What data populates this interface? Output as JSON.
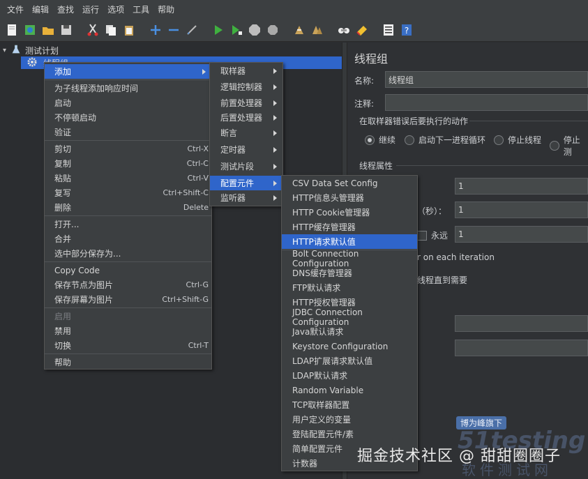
{
  "menubar": [
    "文件",
    "编辑",
    "查找",
    "运行",
    "选项",
    "工具",
    "帮助"
  ],
  "toolbar_icons": [
    "new-icon",
    "templates-icon",
    "open-icon",
    "save-icon",
    "cut-icon",
    "copy-icon",
    "paste-icon",
    "expand-icon",
    "collapse-icon",
    "toggle-icon",
    "start-icon",
    "start-no-pause-icon",
    "stop-icon",
    "shutdown-icon",
    "clear-icon",
    "clear-all-icon",
    "search-icon",
    "reset-search-icon",
    "function-helper-icon",
    "help-icon"
  ],
  "tree": {
    "test_plan": "测试计划",
    "thread_group": "线程组"
  },
  "context_menu": {
    "items": [
      {
        "label": "添加",
        "submenu": true,
        "highlight": true
      },
      {
        "sep": true
      },
      {
        "label": "为子线程添加响应时间"
      },
      {
        "label": "启动"
      },
      {
        "label": "不停顿启动"
      },
      {
        "label": "验证"
      },
      {
        "sep": true
      },
      {
        "label": "剪切",
        "shortcut": "Ctrl-X"
      },
      {
        "label": "复制",
        "shortcut": "Ctrl-C"
      },
      {
        "label": "粘贴",
        "shortcut": "Ctrl-V"
      },
      {
        "label": "复写",
        "shortcut": "Ctrl+Shift-C"
      },
      {
        "label": "删除",
        "shortcut": "Delete"
      },
      {
        "sep": true
      },
      {
        "label": "打开..."
      },
      {
        "label": "合并"
      },
      {
        "label": "选中部分保存为..."
      },
      {
        "sep": true
      },
      {
        "label": "Copy Code"
      },
      {
        "label": "保存节点为图片",
        "shortcut": "Ctrl-G"
      },
      {
        "label": "保存屏幕为图片",
        "shortcut": "Ctrl+Shift-G"
      },
      {
        "sep": true
      },
      {
        "label": "启用",
        "disabled": true
      },
      {
        "label": "禁用"
      },
      {
        "label": "切换",
        "shortcut": "Ctrl-T"
      },
      {
        "sep": true
      },
      {
        "label": "帮助"
      }
    ]
  },
  "add_submenu": [
    {
      "label": "取样器"
    },
    {
      "label": "逻辑控制器"
    },
    {
      "label": "前置处理器"
    },
    {
      "label": "后置处理器"
    },
    {
      "label": "断言"
    },
    {
      "label": "定时器"
    },
    {
      "label": "测试片段"
    },
    {
      "label": "配置元件",
      "highlight": true
    },
    {
      "label": "监听器"
    }
  ],
  "config_submenu": [
    "CSV Data Set Config",
    "HTTP信息头管理器",
    "HTTP Cookie管理器",
    "HTTP缓存管理器",
    "HTTP请求默认值",
    "Bolt Connection Configuration",
    "DNS缓存管理器",
    "FTP默认请求",
    "HTTP授权管理器",
    "JDBC Connection Configuration",
    "Java默认请求",
    "Keystore Configuration",
    "LDAP扩展请求默认值",
    "LDAP默认请求",
    "Random Variable",
    "TCP取样器配置",
    "用户定义的变量",
    "登陆配置元件/素",
    "简单配置元件",
    "计数器"
  ],
  "config_highlight_index": 4,
  "right_panel": {
    "title": "线程组",
    "name_label": "名称:",
    "name_value": "线程组",
    "comment_label": "注释:",
    "error_action_label": "在取样器错误后要执行的动作",
    "radios": [
      "继续",
      "启动下一进程循环",
      "停止线程",
      "停止测"
    ],
    "thread_props_label": "线程属性",
    "field1_value": "1",
    "ramp_label": "（秒）：",
    "field2_value": "1",
    "forever_label": "永远",
    "field3_value": "1",
    "iteration_text": "r on each iteration",
    "delay_text": "线程直到需要"
  },
  "watermark": {
    "text": "掘金技术社区 @ 甜甜圈圈子",
    "badge": "博为峰旗下",
    "logo": "51testing",
    "sub": "软件测试网"
  }
}
